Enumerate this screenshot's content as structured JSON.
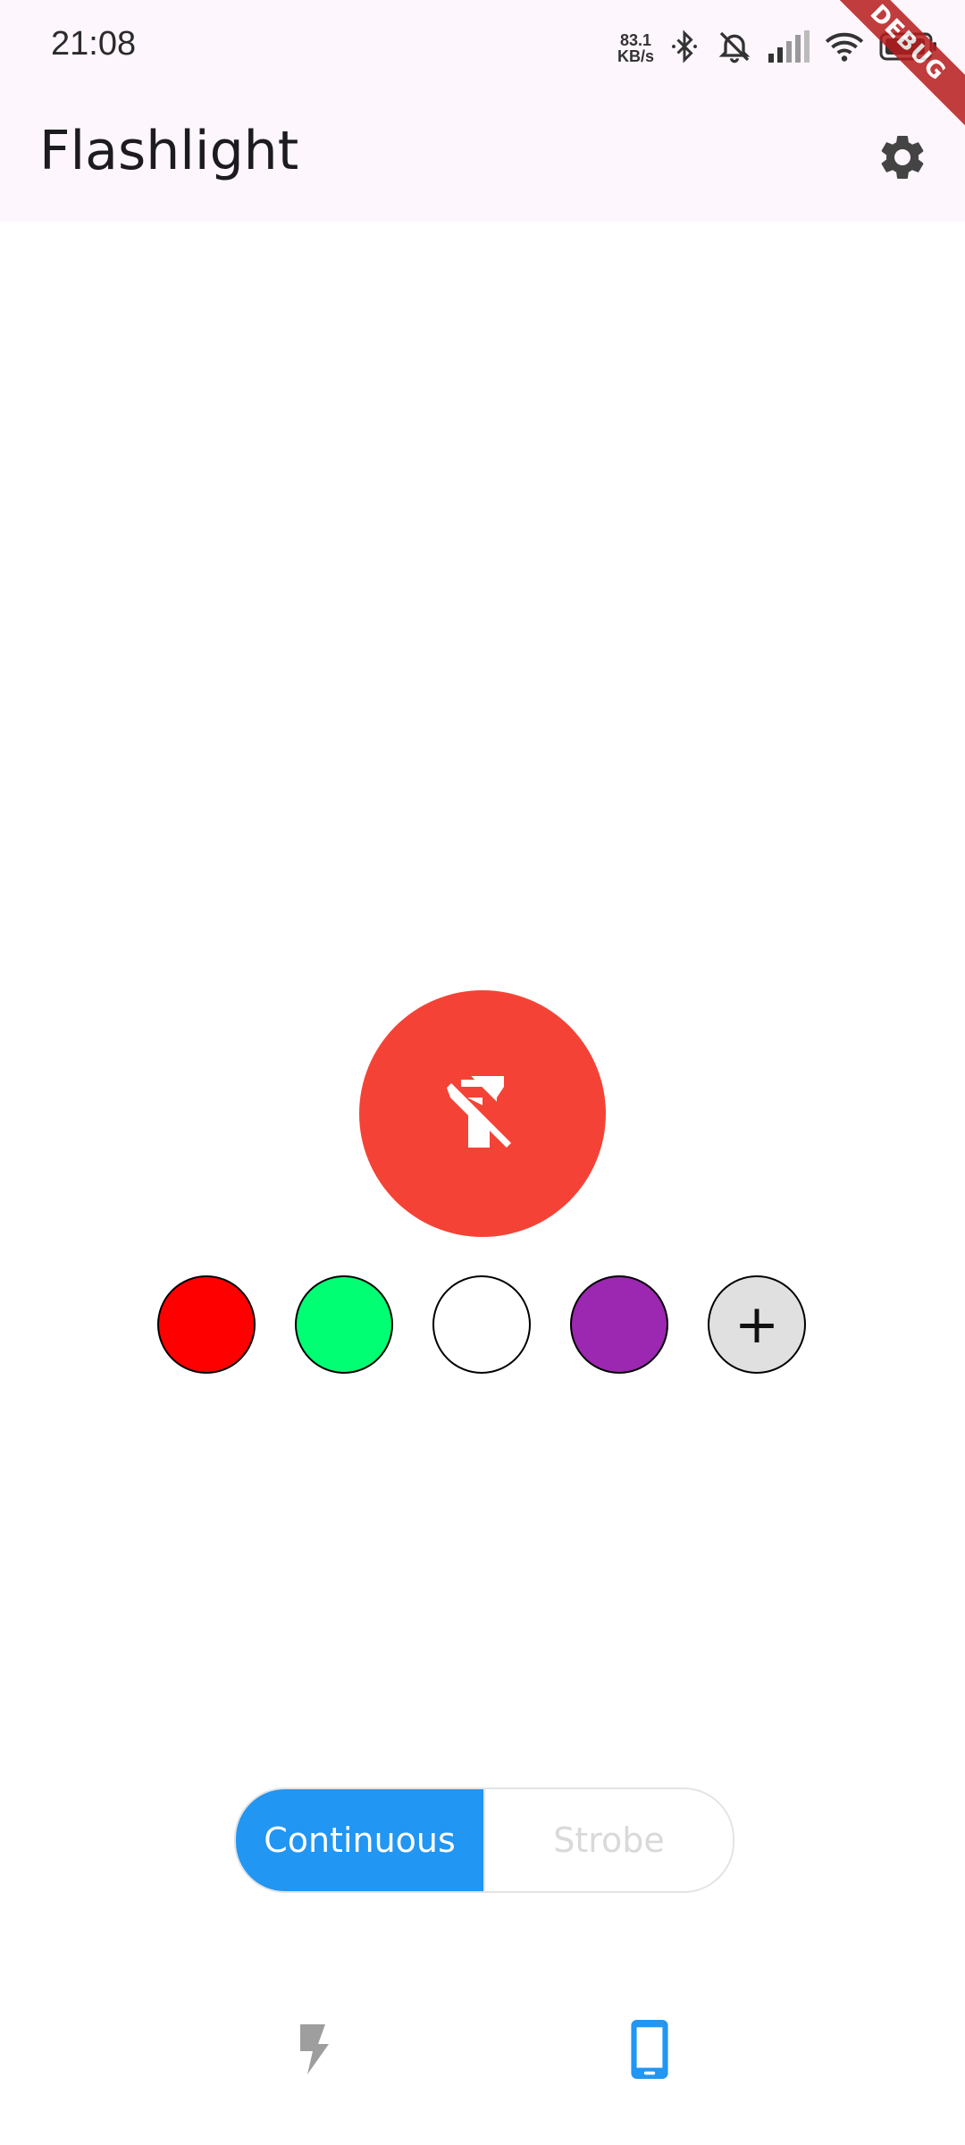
{
  "status_bar": {
    "time": "21:08",
    "net_speed_value": "83.1",
    "net_speed_unit": "KB/s",
    "icons": [
      "bluetooth-icon",
      "muted-bell-icon",
      "signal-icon",
      "wifi-icon",
      "battery-icon"
    ]
  },
  "debug_banner": "DEBUG",
  "app_bar": {
    "title": "Flashlight",
    "settings_icon": "gear-icon"
  },
  "main_toggle": {
    "icon": "flashlight-off-icon",
    "color": "#f44336",
    "state": "off"
  },
  "color_swatches": [
    {
      "name": "red",
      "color": "#ff0000"
    },
    {
      "name": "green",
      "color": "#00ff73"
    },
    {
      "name": "white",
      "color": "#ffffff"
    },
    {
      "name": "purple",
      "color": "#9c27b0"
    }
  ],
  "add_color": {
    "symbol": "+",
    "color": "#e0e0e0"
  },
  "mode_selector": {
    "options": [
      "Continuous",
      "Strobe"
    ],
    "selected": "Continuous",
    "active_color": "#2196f3"
  },
  "bottom_nav": {
    "items": [
      {
        "icon": "flash-icon",
        "selected": false
      },
      {
        "icon": "phone-icon",
        "selected": true
      }
    ],
    "selected_color": "#2196f3"
  }
}
